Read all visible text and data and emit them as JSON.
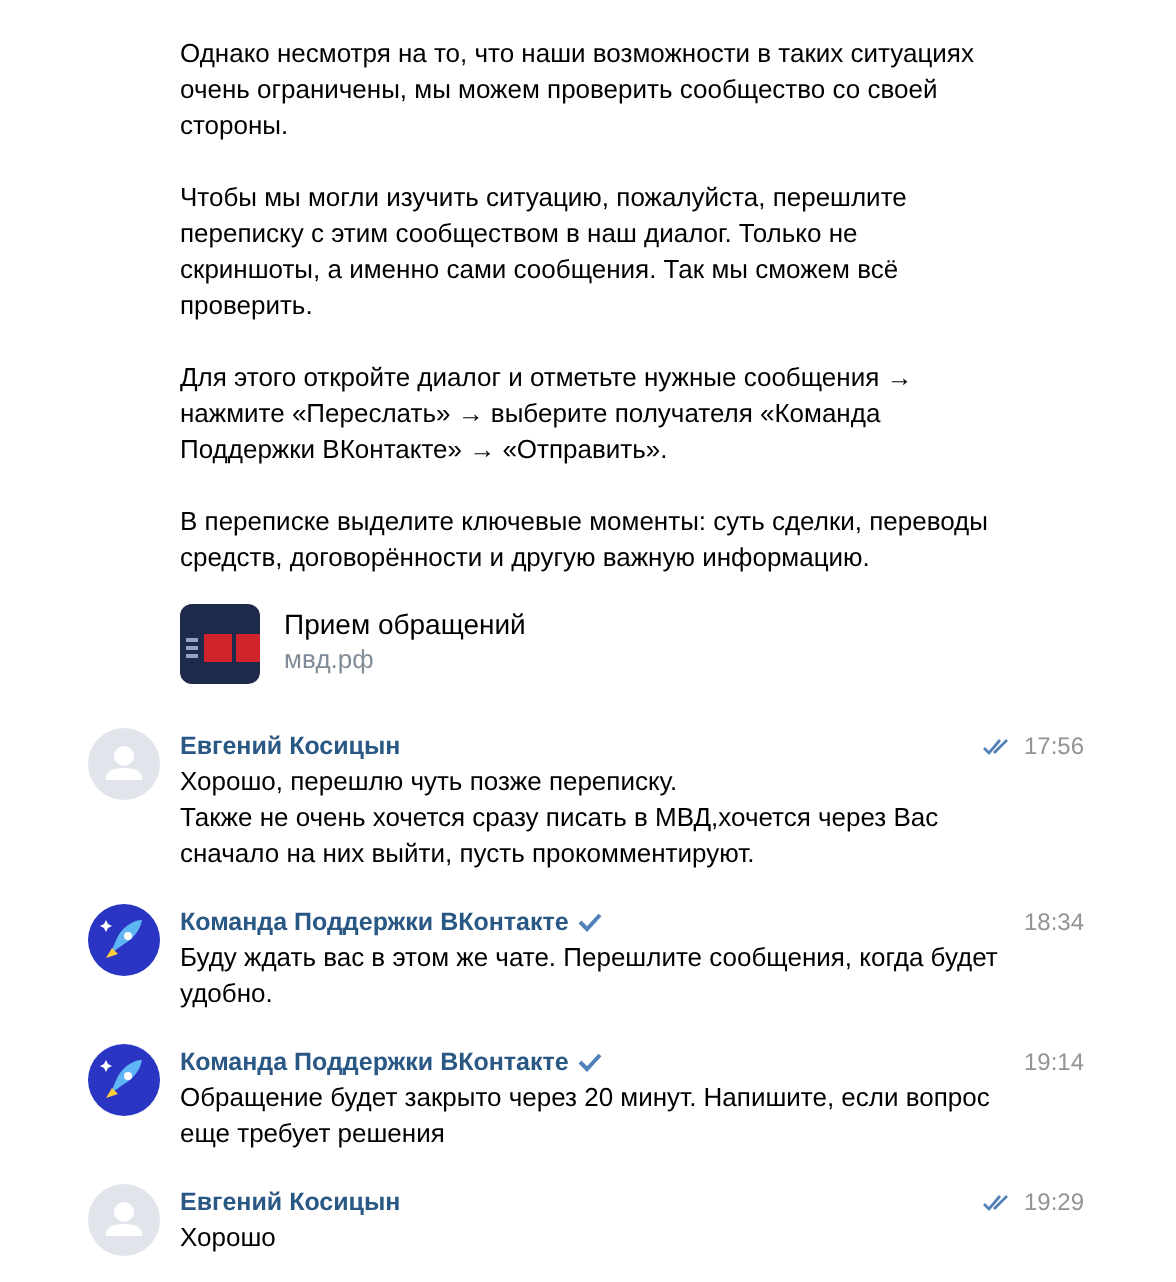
{
  "support_message": {
    "paragraphs": [
      "Однако несмотря на то, что наши возможности в таких ситуациях очень ограничены, мы можем проверить сообщество со своей стороны.",
      "Чтобы мы могли изучить ситуацию, пожалуйста, перешлите переписку с этим сообществом в наш диалог. Только не скриншоты, а именно сами сообщения. Так мы сможем всё проверить.",
      "Для этого откройте диалог и отметьте нужные сообщения → нажмите «Переслать» → выберите получателя «Команда Поддержки ВКонтакте» → «Отправить».",
      "В переписке выделите ключевые моменты: суть сделки, переводы средств, договорённости и другую важную информацию."
    ],
    "link": {
      "kind": "picture",
      "title": "Прием обращений",
      "domain": "мвд.рф"
    }
  },
  "messages": [
    {
      "kind": "person",
      "author": "Евгений Косицын",
      "verified": false,
      "read": true,
      "time": "17:56",
      "lines": [
        "Хорошо, перешлю чуть позже переписку.",
        "Также не очень хочется сразу писать в МВД,хочется через Вас сначало на них выйти, пусть прокомментируют."
      ]
    },
    {
      "kind": "rocket",
      "author": "Команда Поддержки ВКонтакте",
      "verified": true,
      "read": false,
      "time": "18:34",
      "lines": [
        "Буду ждать вас в этом же чате. Перешлите сообщения, когда будет удобно."
      ]
    },
    {
      "kind": "rocket",
      "author": "Команда Поддержки ВКонтакте",
      "verified": true,
      "read": false,
      "time": "19:14",
      "lines": [
        "Обращение будет закрыто через 20 минут. Напишите, если вопрос еще требует решения"
      ]
    },
    {
      "kind": "person",
      "author": "Евгений Косицын",
      "verified": false,
      "read": true,
      "time": "19:29",
      "lines": [
        "Хорошо"
      ]
    }
  ]
}
